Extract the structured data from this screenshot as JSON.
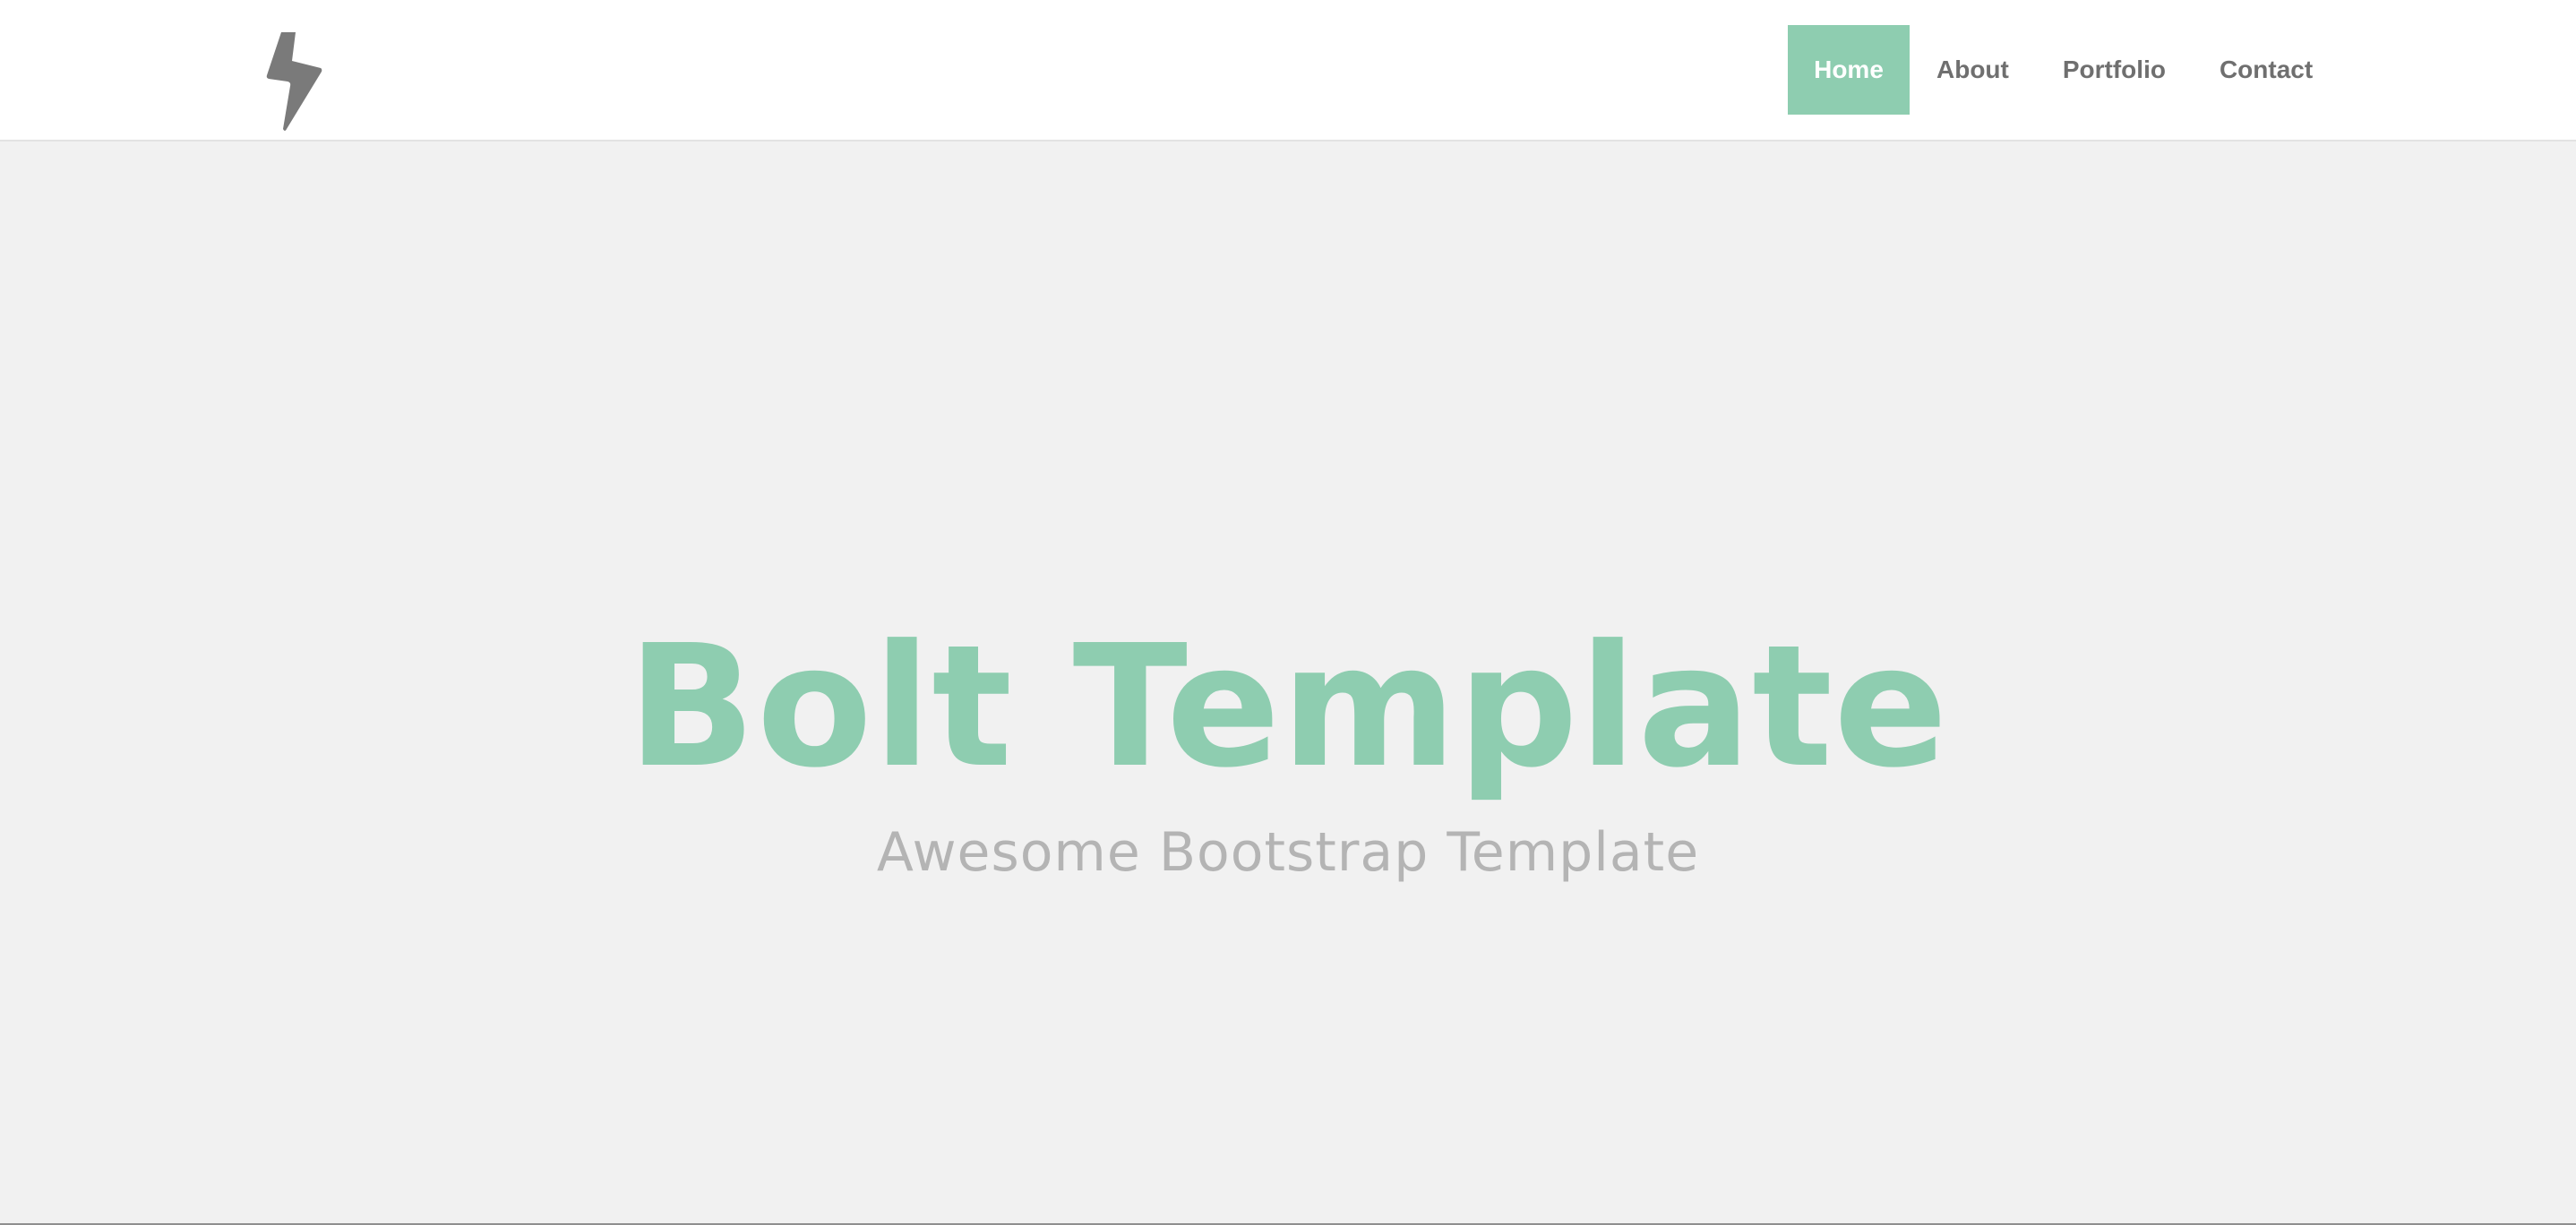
{
  "header": {
    "logo_icon": "lightning-bolt-icon",
    "nav": [
      {
        "label": "Home",
        "active": true
      },
      {
        "label": "About",
        "active": false
      },
      {
        "label": "Portfolio",
        "active": false
      },
      {
        "label": "Contact",
        "active": false
      }
    ]
  },
  "hero": {
    "title": "Bolt Template",
    "subtitle": "Awesome Bootstrap Template"
  },
  "colors": {
    "accent": "#8ecdb0",
    "nav_text": "#6f6f6f",
    "hero_background": "#f1f1f1",
    "subtitle_text": "#b4b4b4"
  }
}
